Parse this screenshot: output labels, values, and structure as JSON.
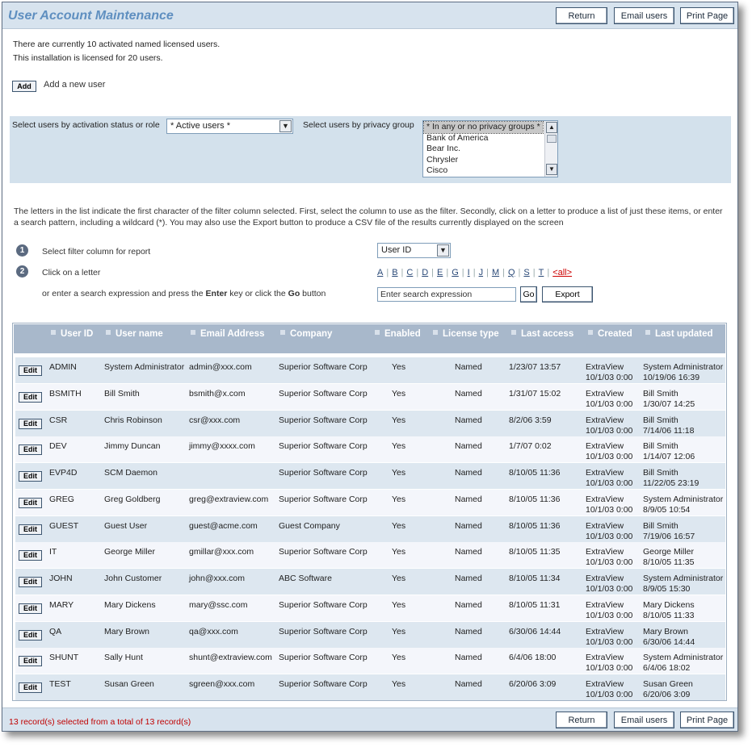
{
  "window": {
    "title": "User Account Maintenance"
  },
  "toolbar": {
    "return_label": "Return",
    "email_label": "Email users",
    "print_label": "Print Page"
  },
  "info": {
    "line1": "There are currently 10 activated named licensed users.",
    "line2": "This installation is licensed for 20 users."
  },
  "add": {
    "button_label": "Add",
    "link_label": "Add a new user"
  },
  "filters": {
    "status_label": "Select users by activation status or role",
    "status_value": "* Active users *",
    "privacy_label": "Select users by privacy group",
    "privacy_options": [
      "* In any or no privacy groups *",
      "Bank of America",
      "Bear Inc.",
      "Chrysler",
      "Cisco"
    ]
  },
  "description": "The letters in the list indicate the first character of the filter column selected. First, select the column to use as the filter. Secondly, click on a letter to produce a list of just these items, or enter a search pattern, including a wildcard (*). You may also use the Export button to produce a CSV file of the results currently displayed on the screen",
  "steps": {
    "step1_num": "1",
    "step1_label": "Select filter column for report",
    "filter_column": "User ID",
    "step2_num": "2",
    "step2_label": "Click on a letter",
    "letters": [
      "A",
      "B",
      "C",
      "D",
      "E",
      "G",
      "I",
      "J",
      "M",
      "Q",
      "S",
      "T"
    ],
    "all_label": "<all>",
    "search_prefix": "or enter a search expression and press the ",
    "search_enter": "Enter",
    "search_mid": " key or click the ",
    "search_go": "Go",
    "search_suffix": " button",
    "search_placeholder": "Enter search expression",
    "go_label": "Go",
    "export_label": "Export"
  },
  "table": {
    "edit_label": "Edit",
    "columns": [
      "User ID",
      "User name",
      "Email Address",
      "Company",
      "Enabled",
      "License type",
      "Last access",
      "Created",
      "Last updated"
    ],
    "rows": [
      {
        "id": "ADMIN",
        "name": "System Administrator",
        "email": "admin@xxx.com",
        "company": "Superior Software Corp",
        "enabled": "Yes",
        "license": "Named",
        "access": "1/23/07 13:57",
        "created_by": "ExtraView",
        "created_on": "10/1/03 0:00",
        "updated_by": "System Administrator",
        "updated_on": "10/19/06 16:39"
      },
      {
        "id": "BSMITH",
        "name": "Bill Smith",
        "email": "bsmith@x.com",
        "company": "Superior Software Corp",
        "enabled": "Yes",
        "license": "Named",
        "access": "1/31/07 15:02",
        "created_by": "ExtraView",
        "created_on": "10/1/03 0:00",
        "updated_by": "Bill Smith",
        "updated_on": "1/30/07 14:25"
      },
      {
        "id": "CSR",
        "name": "Chris Robinson",
        "email": "csr@xxx.com",
        "company": "Superior Software Corp",
        "enabled": "Yes",
        "license": "Named",
        "access": "8/2/06 3:59",
        "created_by": "ExtraView",
        "created_on": "10/1/03 0:00",
        "updated_by": "Bill Smith",
        "updated_on": "7/14/06 11:18"
      },
      {
        "id": "DEV",
        "name": "Jimmy Duncan",
        "email": "jimmy@xxxx.com",
        "company": "Superior Software Corp",
        "enabled": "Yes",
        "license": "Named",
        "access": "1/7/07 0:02",
        "created_by": "ExtraView",
        "created_on": "10/1/03 0:00",
        "updated_by": "Bill Smith",
        "updated_on": "1/14/07 12:06"
      },
      {
        "id": "EVP4D",
        "name": "SCM Daemon",
        "email": "",
        "company": "Superior Software Corp",
        "enabled": "Yes",
        "license": "Named",
        "access": "8/10/05 11:36",
        "created_by": "ExtraView",
        "created_on": "10/1/03 0:00",
        "updated_by": "Bill Smith",
        "updated_on": "11/22/05 23:19"
      },
      {
        "id": "GREG",
        "name": "Greg Goldberg",
        "email": "greg@extraview.com",
        "company": "Superior Software Corp",
        "enabled": "Yes",
        "license": "Named",
        "access": "8/10/05 11:36",
        "created_by": "ExtraView",
        "created_on": "10/1/03 0:00",
        "updated_by": "System Administrator",
        "updated_on": "8/9/05 10:54"
      },
      {
        "id": "GUEST",
        "name": "Guest User",
        "email": "guest@acme.com",
        "company": "Guest Company",
        "enabled": "Yes",
        "license": "Named",
        "access": "8/10/05 11:36",
        "created_by": "ExtraView",
        "created_on": "10/1/03 0:00",
        "updated_by": "Bill Smith",
        "updated_on": "7/19/06 16:57"
      },
      {
        "id": "IT",
        "name": "George Miller",
        "email": "gmillar@xxx.com",
        "company": "Superior Software Corp",
        "enabled": "Yes",
        "license": "Named",
        "access": "8/10/05 11:35",
        "created_by": "ExtraView",
        "created_on": "10/1/03 0:00",
        "updated_by": "George Miller",
        "updated_on": "8/10/05 11:35"
      },
      {
        "id": "JOHN",
        "name": "John Customer",
        "email": "john@xxx.com",
        "company": "ABC Software",
        "enabled": "Yes",
        "license": "Named",
        "access": "8/10/05 11:34",
        "created_by": "ExtraView",
        "created_on": "10/1/03 0:00",
        "updated_by": "System Administrator",
        "updated_on": "8/9/05 15:30"
      },
      {
        "id": "MARY",
        "name": "Mary Dickens",
        "email": "mary@ssc.com",
        "company": "Superior Software Corp",
        "enabled": "Yes",
        "license": "Named",
        "access": "8/10/05 11:31",
        "created_by": "ExtraView",
        "created_on": "10/1/03 0:00",
        "updated_by": "Mary Dickens",
        "updated_on": "8/10/05 11:33"
      },
      {
        "id": "QA",
        "name": "Mary Brown",
        "email": "qa@xxx.com",
        "company": "Superior Software Corp",
        "enabled": "Yes",
        "license": "Named",
        "access": "6/30/06 14:44",
        "created_by": "ExtraView",
        "created_on": "10/1/03 0:00",
        "updated_by": "Mary Brown",
        "updated_on": "6/30/06 14:44"
      },
      {
        "id": "SHUNT",
        "name": "Sally Hunt",
        "email": "shunt@extraview.com",
        "company": "Superior Software Corp",
        "enabled": "Yes",
        "license": "Named",
        "access": "6/4/06 18:00",
        "created_by": "ExtraView",
        "created_on": "10/1/03 0:00",
        "updated_by": "System Administrator",
        "updated_on": "6/4/06 18:02"
      },
      {
        "id": "TEST",
        "name": "Susan Green",
        "email": "sgreen@xxx.com",
        "company": "Superior Software Corp",
        "enabled": "Yes",
        "license": "Named",
        "access": "6/20/06 3:09",
        "created_by": "ExtraView",
        "created_on": "10/1/03 0:00",
        "updated_by": "Susan Green",
        "updated_on": "6/20/06 3:09"
      }
    ]
  },
  "footer": {
    "message": "13 record(s) selected from a total of 13 record(s)"
  },
  "colors": {
    "header_bg": "#d7e3ee",
    "title": "#5f8fc0",
    "table_header": "#a8b8cb",
    "row_odd": "#dde7f0",
    "row_even": "#f4f6fb",
    "footer_msg": "#c00000",
    "all_link": "#cc0000"
  },
  "icons": {
    "dropdown": "chevron-down-icon",
    "scroll_up": "scroll-up-icon",
    "scroll_down": "scroll-down-icon",
    "sort": "sort-marker-icon"
  }
}
